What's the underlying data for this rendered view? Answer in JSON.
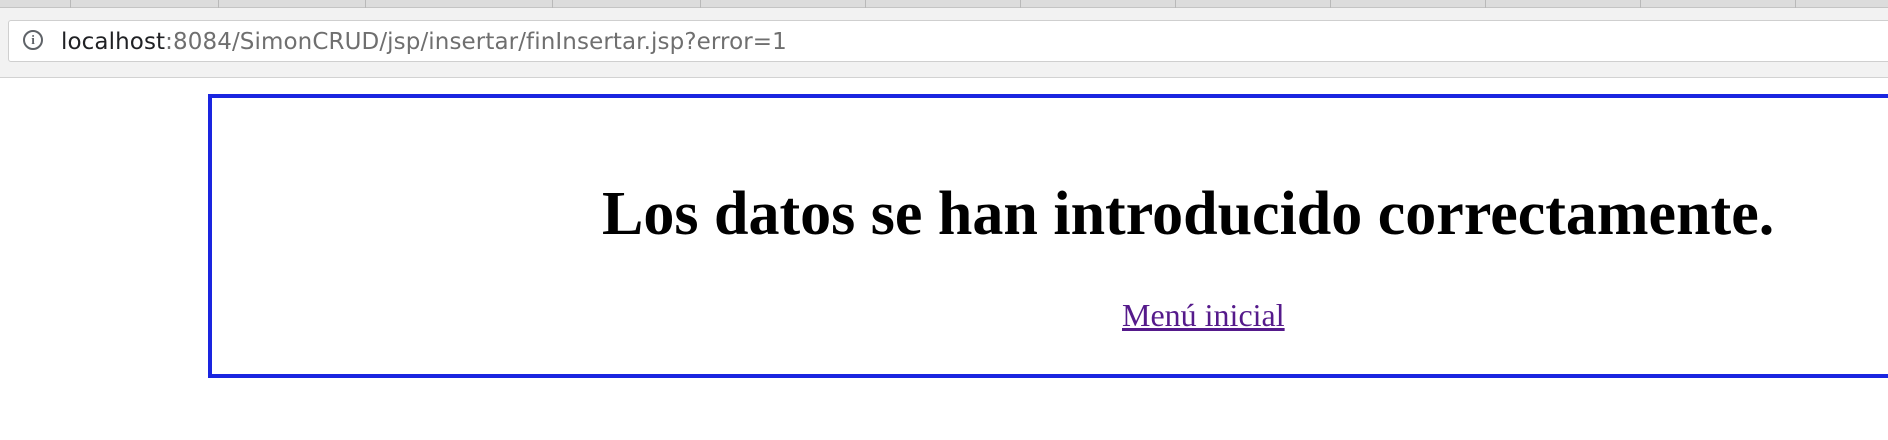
{
  "browser": {
    "address_bar": {
      "host": "localhost",
      "path": ":8084/SimonCRUD/jsp/insertar/finInsertar.jsp?error=1",
      "info_icon": "info-icon"
    }
  },
  "page": {
    "heading": "Los datos se han introducido correctamente.",
    "menu_link": "Menú inicial",
    "colors": {
      "frame_border": "#1a25e0",
      "visited_link": "#551a8b"
    }
  }
}
